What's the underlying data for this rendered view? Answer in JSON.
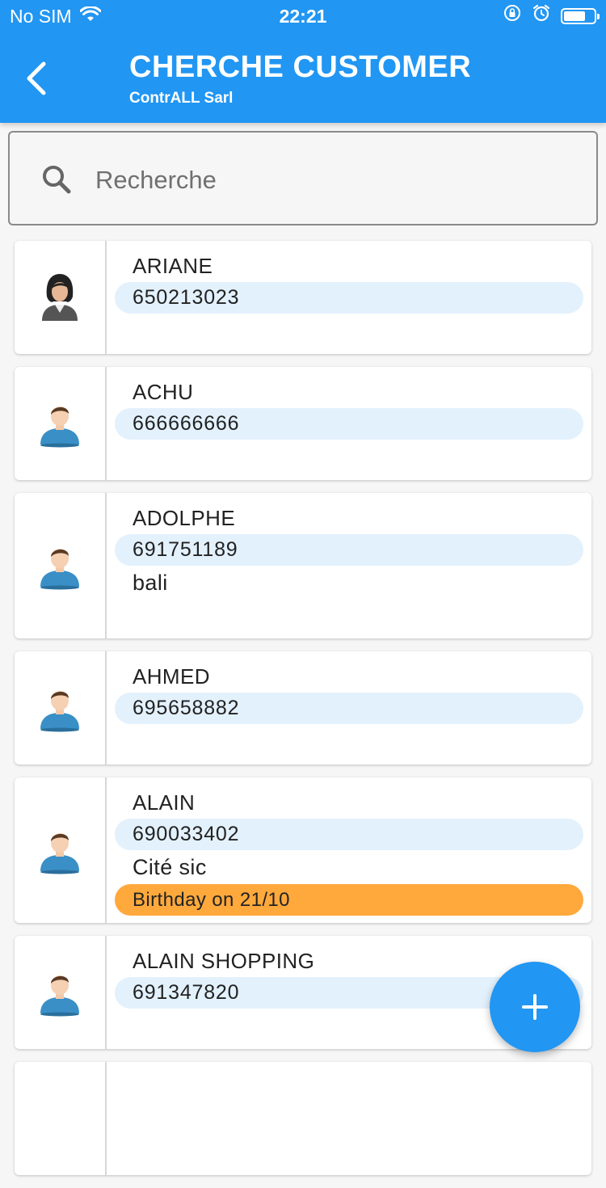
{
  "status_bar": {
    "carrier": "No SIM",
    "time": "22:21"
  },
  "header": {
    "title": "CHERCHE CUSTOMER",
    "subtitle": "ContrALL Sarl",
    "background_color": "#2196f3"
  },
  "search": {
    "placeholder": "Recherche",
    "value": ""
  },
  "customers": [
    {
      "name": "ARIANE",
      "phone": "650213023",
      "avatar": "female-avatar-icon"
    },
    {
      "name": "ACHU",
      "phone": "666666666",
      "avatar": "male-avatar-icon"
    },
    {
      "name": "ADOLPHE",
      "phone": "691751189",
      "address": "bali",
      "avatar": "male-avatar-icon"
    },
    {
      "name": "AHMED",
      "phone": "695658882",
      "avatar": "male-avatar-icon"
    },
    {
      "name": "ALAIN",
      "phone": "690033402",
      "address": "Cité sic",
      "birthday": "Birthday on 21/10",
      "avatar": "male-avatar-icon"
    },
    {
      "name": "ALAIN SHOPPING",
      "phone": "691347820",
      "avatar": "male-avatar-icon"
    }
  ],
  "colors": {
    "phone_pill": "#e3f1fd",
    "birthday_pill": "#ffa93c",
    "fab": "#2196f3"
  },
  "fab": {
    "icon": "plus-icon"
  }
}
